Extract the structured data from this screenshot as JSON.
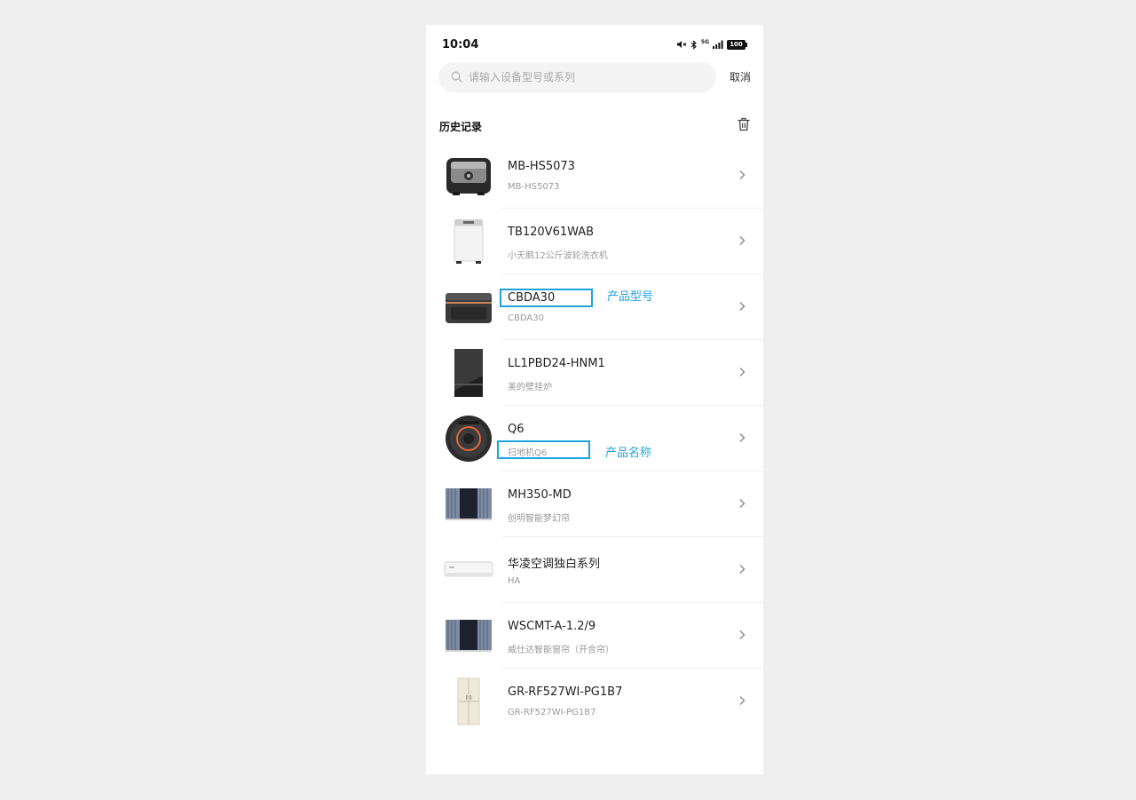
{
  "status_bar": {
    "time": "10:04",
    "network": "5G",
    "battery": "100"
  },
  "search": {
    "placeholder": "请输入设备型号或系列",
    "value": "",
    "cancel_label": "取消"
  },
  "history": {
    "title": "历史记录",
    "items": [
      {
        "model": "MB-HS5073",
        "name": "MB-HS5073",
        "icon": "rice-cooker-icon"
      },
      {
        "model": "TB120V61WAB",
        "name": "小天鹅12公斤波轮洗衣机",
        "icon": "washing-machine-icon"
      },
      {
        "model": "CBDA30",
        "name": "CBDA30",
        "icon": "countertop-appliance-icon"
      },
      {
        "model": "LL1PBD24-HNM1",
        "name": "美的壁挂炉",
        "icon": "wall-boiler-icon"
      },
      {
        "model": "Q6",
        "name": "扫地机Q6",
        "icon": "robot-vacuum-icon"
      },
      {
        "model": "MH350-MD",
        "name": "创明智能梦幻帘",
        "icon": "curtain-icon"
      },
      {
        "model": "华凌空调独白系列",
        "name": "HA",
        "icon": "air-conditioner-icon"
      },
      {
        "model": "WSCMT-A-1.2/9",
        "name": "威仕达智能窗帘（开合帘）",
        "icon": "curtain-icon"
      },
      {
        "model": "GR-RF527WI-PG1B7",
        "name": "GR-RF527WI-PG1B7",
        "icon": "refrigerator-icon"
      }
    ]
  },
  "annotations": {
    "model_label": "产品型号",
    "name_label": "产品名称"
  },
  "colors": {
    "annotation": "#1ea3e0",
    "background": "#efefef"
  }
}
